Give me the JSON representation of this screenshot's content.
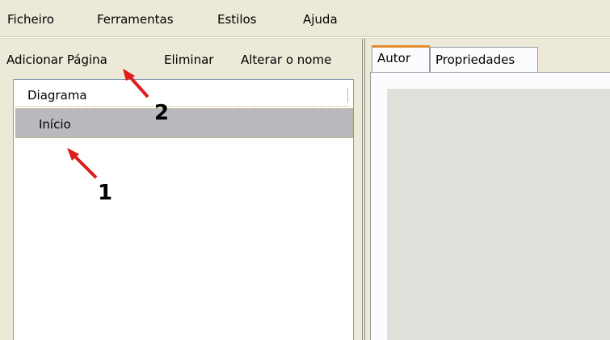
{
  "menu": {
    "items": [
      {
        "label": "Ficheiro"
      },
      {
        "label": "Ferramentas"
      },
      {
        "label": "Estilos"
      },
      {
        "label": "Ajuda"
      }
    ]
  },
  "toolbar": {
    "add_page": "Adicionar Página",
    "delete": "Eliminar",
    "rename": "Alterar o nome"
  },
  "tree": {
    "root_label": "Diagrama",
    "selected_node": "Início"
  },
  "tabs": [
    {
      "label": "Autor",
      "active": true
    },
    {
      "label": "Propriedades",
      "active": false
    }
  ],
  "annotations": {
    "label_1": "1",
    "label_2": "2",
    "arrow_color": "#e01c1c"
  },
  "colors": {
    "window_bg": "#ece9d8",
    "selection_bg": "#b9b9c0",
    "active_tab_accent": "#e68b2c"
  }
}
